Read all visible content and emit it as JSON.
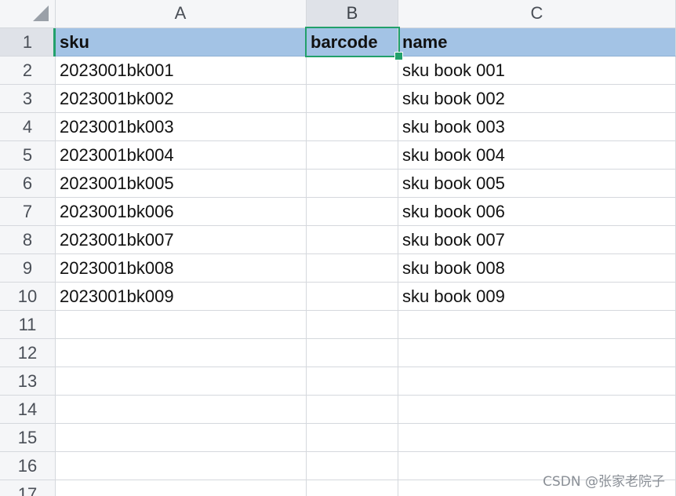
{
  "columns": [
    "A",
    "B",
    "C"
  ],
  "row_numbers": [
    "1",
    "2",
    "3",
    "4",
    "5",
    "6",
    "7",
    "8",
    "9",
    "10",
    "11",
    "12",
    "13",
    "14",
    "15",
    "16",
    "17"
  ],
  "rows": [
    {
      "a": "sku",
      "b": "barcode",
      "c": "name"
    },
    {
      "a": "2023001bk001",
      "b": "",
      "c": "sku book 001"
    },
    {
      "a": "2023001bk002",
      "b": "",
      "c": "sku book 002"
    },
    {
      "a": "2023001bk003",
      "b": "",
      "c": "sku book 003"
    },
    {
      "a": "2023001bk004",
      "b": "",
      "c": "sku book 004"
    },
    {
      "a": "2023001bk005",
      "b": "",
      "c": "sku book 005"
    },
    {
      "a": "2023001bk006",
      "b": "",
      "c": "sku book 006"
    },
    {
      "a": "2023001bk007",
      "b": "",
      "c": "sku book 007"
    },
    {
      "a": "2023001bk008",
      "b": "",
      "c": "sku book 008"
    },
    {
      "a": "2023001bk009",
      "b": "",
      "c": "sku book 009"
    },
    {
      "a": "",
      "b": "",
      "c": ""
    },
    {
      "a": "",
      "b": "",
      "c": ""
    },
    {
      "a": "",
      "b": "",
      "c": ""
    },
    {
      "a": "",
      "b": "",
      "c": ""
    },
    {
      "a": "",
      "b": "",
      "c": ""
    },
    {
      "a": "",
      "b": "",
      "c": ""
    },
    {
      "a": "",
      "b": "",
      "c": ""
    }
  ],
  "selected_cell": "B1",
  "colors": {
    "header_row_fill": "#a3c3e5",
    "selection": "#22a06b",
    "grid_line": "#d5d8dd"
  },
  "watermark": "CSDN @张家老院子"
}
